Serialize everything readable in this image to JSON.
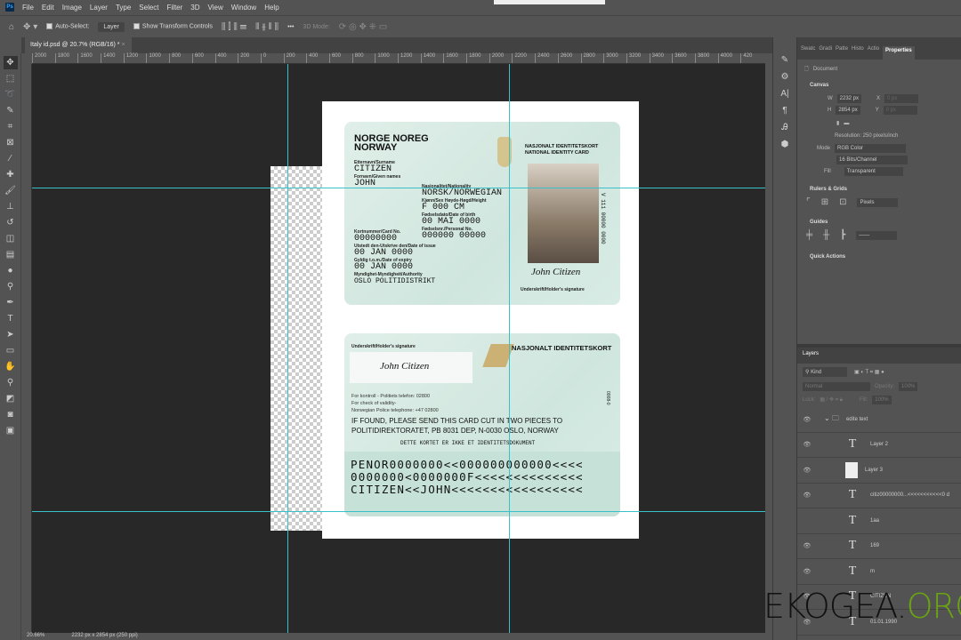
{
  "menu": [
    "File",
    "Edit",
    "Image",
    "Layer",
    "Type",
    "Select",
    "Filter",
    "3D",
    "View",
    "Window",
    "Help"
  ],
  "options": {
    "auto_select": "Auto-Select:",
    "layer_dropdown": "Layer",
    "show_transform": "Show Transform Controls",
    "more": "•••",
    "mode_3d": "3D Mode:"
  },
  "doc_tab": "Italy id.psd @ 20.7% (RGB/16) *",
  "ruler_ticks": [
    "2000",
    "1800",
    "1600",
    "1400",
    "1200",
    "1000",
    "800",
    "600",
    "400",
    "200",
    "0",
    "200",
    "400",
    "600",
    "800",
    "1000",
    "1200",
    "1400",
    "1600",
    "1800",
    "2000",
    "2200",
    "2400",
    "2600",
    "2800",
    "3000",
    "3200",
    "3400",
    "3600",
    "3800",
    "4000",
    "420"
  ],
  "status": {
    "zoom": "20.66%",
    "size": "2232 px x 2854 px (250 ppi)"
  },
  "card_front": {
    "country": "NORGE NOREG",
    "country2": "NORWAY",
    "title": "NASJONALT IDENTITETSKORT",
    "title2": "NATIONAL IDENTITY CARD",
    "surname_label": "Etternavn/Surname",
    "surname": "CITIZEN",
    "given_label": "Fornavn/Given names",
    "given": "JOHN",
    "nat_label": "Nasjonalitet/Nationality",
    "nat": "NORSK/NORWEGIAN",
    "sex_label": "Kjønn/Sex   Høyde-Høgd/Height",
    "sex": "F   000 CM",
    "dob_label": "Fødselsdato/Date of birth",
    "dob": "00  MAI  0000",
    "card_label": "Kortnummer/Card No.",
    "card_no": "00000000",
    "pn_label": "Fødselsnr./Personal No.",
    "pn": "000000 00000",
    "issue_label": "Utstedt den-Utskrive den/Date of issue",
    "issue": "00 JAN 0000",
    "expiry_label": "Gyldig t.o.m./Date of expiry",
    "expiry": "00 JAN 0000",
    "auth_label": "Myndighet-Myndigheit/Authority",
    "auth": "OSLO POLITIDISTRIKT",
    "vertical": "V 111 00000 0000",
    "signature": "John  Citizen",
    "sig_label": "Underskrift/Holder's signature"
  },
  "card_back": {
    "sig_label": "Underskrift/Holder's signature",
    "signature": "John  Citizen",
    "title": "NASJONALT IDENTITETSKORT",
    "l1": "For kontroll - Politiets telefon: 02800",
    "l2": "For check of validity-",
    "l3": "Norwegian Police telephone: +47 02800",
    "found1": "IF FOUND, PLEASE SEND THIS CARD CUT IN TWO PIECES TO",
    "found2": "POLITIDIREKTORATET, PB 8031 DEP, N-0030 OSLO, NORWAY",
    "notice": "DETTE KORTET ER IKKE ET IDENTITETSDOKUMENT",
    "vertical": "0008-0",
    "mrz": [
      "PENOR0000000<<000000000000<<<<",
      "0000000<0000000F<<<<<<<<<<<<<<",
      "CITIZEN<<JOHN<<<<<<<<<<<<<<<<<"
    ]
  },
  "panel": {
    "tabs": [
      "Swatc",
      "Gradi",
      "Patte",
      "Histo",
      "Actio",
      "Properties"
    ],
    "document": "Document",
    "canvas": "Canvas",
    "w_label": "W",
    "w": "2232 px",
    "h_label": "H",
    "h": "2854 px",
    "x_label": "X",
    "y_label": "Y",
    "x": "0 px",
    "y": "0 px",
    "resolution": "Resolution: 250 pixels/inch",
    "mode_label": "Mode",
    "mode": "RGB Color",
    "depth": "16 Bits/Channel",
    "fill_label": "Fill",
    "fill": "Transparent",
    "rulers": "Rulers & Grids",
    "units": "Pixels",
    "guides": "Guides",
    "quick": "Quick Actions"
  },
  "layers": {
    "tab": "Layers",
    "kind": "Kind",
    "blend": "Normal",
    "opacity_label": "Opacity:",
    "opacity": "100%",
    "lock": "Lock:",
    "fill_label": "Fill:",
    "fill": "100%",
    "items": [
      {
        "name": "edite text",
        "type": "group"
      },
      {
        "name": "Layer 2",
        "type": "text"
      },
      {
        "name": "Layer 3",
        "type": "pixel"
      },
      {
        "name": "citiz00000000...<<<<<<<<<<<0 d",
        "type": "text"
      },
      {
        "name": "1aa",
        "type": "text"
      },
      {
        "name": "169",
        "type": "text"
      },
      {
        "name": "m",
        "type": "text"
      },
      {
        "name": "CITIZEN",
        "type": "text"
      },
      {
        "name": "01.01.1990",
        "type": "text"
      }
    ]
  },
  "watermark": {
    "a": "EKOGEA.",
    "b": "ORG"
  }
}
